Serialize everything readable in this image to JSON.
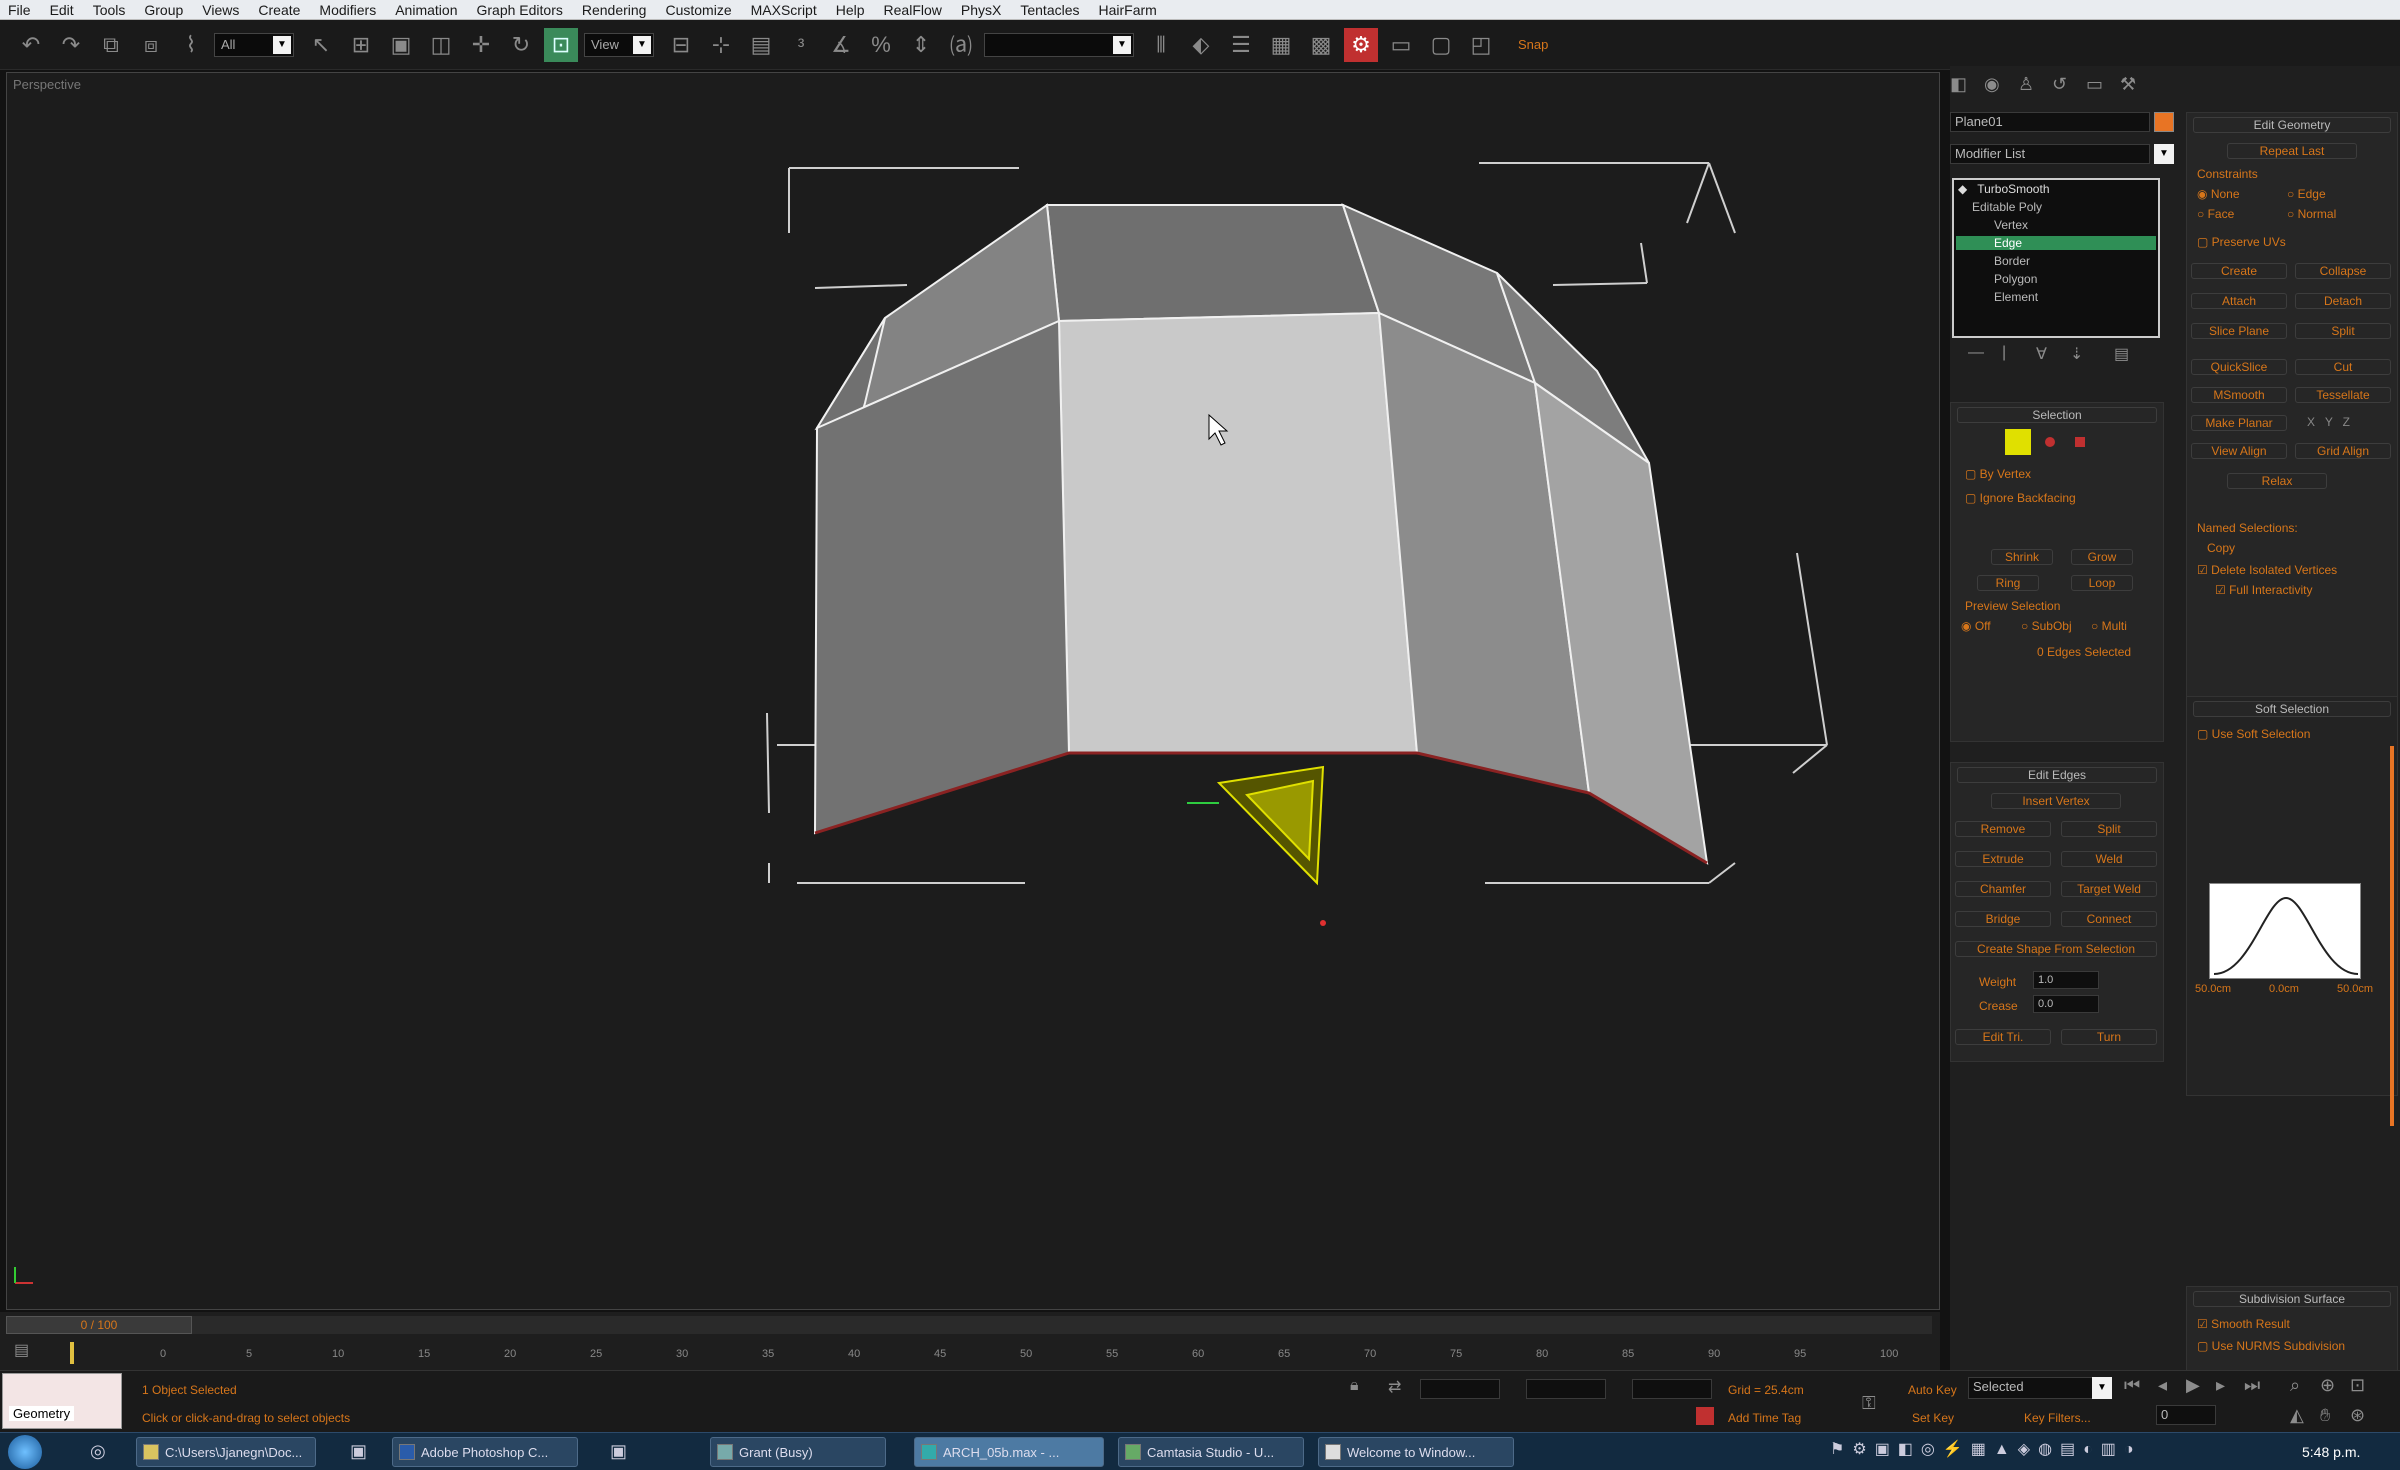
{
  "menu": [
    "File",
    "Edit",
    "Tools",
    "Group",
    "Views",
    "Create",
    "Modifiers",
    "Animation",
    "Graph Editors",
    "Rendering",
    "Customize",
    "MAXScript",
    "Help",
    "RealFlow",
    "PhysX",
    "Tentacles",
    "HairFarm"
  ],
  "toolbar": {
    "selection_filter": "All",
    "ref_coord": "View",
    "snaps_label": "Snap",
    "named_selection": ""
  },
  "viewport": {
    "label": "Perspective",
    "cursor": "arrow"
  },
  "command_panel": {
    "object_name": "Plane01",
    "modifier_list": "Modifier List",
    "stack": [
      "TurboSmooth",
      "Editable Poly",
      "Vertex",
      "Edge",
      "Border",
      "Polygon",
      "Element"
    ],
    "selected_stack_item": "Edge",
    "selection_rollout": {
      "title": "Selection",
      "by_vertex": "By Vertex",
      "ignore_backfacing": "Ignore Backfacing",
      "shrink": "Shrink",
      "grow": "Grow",
      "ring": "Ring",
      "loop": "Loop",
      "preview_selection": "Preview Selection",
      "off": "Off",
      "subobj": "SubObj",
      "multi": "Multi",
      "status": "0 Edges Selected"
    },
    "edit_edges_rollout": {
      "title": "Edit Edges",
      "insert_vertex": "Insert Vertex",
      "remove": "Remove",
      "split": "Split",
      "extrude": "Extrude",
      "weld": "Weld",
      "chamfer": "Chamfer",
      "target_weld": "Target Weld",
      "bridge": "Bridge",
      "connect": "Connect",
      "create_shape": "Create Shape From Selection",
      "weight_label": "Weight",
      "weight_value": "1.0",
      "crease_label": "Crease",
      "crease_value": "0.0",
      "edit_tri": "Edit Tri.",
      "turn": "Turn"
    },
    "edit_geometry_rollout": {
      "title": "Edit Geometry",
      "repeat_last": "Repeat Last",
      "constraints": "Constraints",
      "none": "None",
      "edge": "Edge",
      "face": "Face",
      "normal": "Normal",
      "preserve_uvs": "Preserve UVs",
      "create": "Create",
      "collapse": "Collapse",
      "attach": "Attach",
      "detach": "Detach",
      "slice_plane": "Slice Plane",
      "split": "Split",
      "quickslice": "QuickSlice",
      "cut": "Cut",
      "msmooth": "MSmooth",
      "tessellate": "Tessellate",
      "make_planar": "Make Planar",
      "x": "X",
      "y": "Y",
      "z": "Z",
      "view_align": "View Align",
      "grid_align": "Grid Align",
      "relax": "Relax",
      "named_selections": "Named Selections:",
      "copy": "Copy",
      "delete_isolated": "Delete Isolated Vertices",
      "full_interactivity": "Full Interactivity"
    },
    "soft_selection_rollout": {
      "title": "Soft Selection",
      "use_soft": "Use Soft Selection",
      "curve_left": "50.0cm",
      "curve_mid": "0.0cm",
      "curve_right": "50.0cm"
    },
    "subdivision_rollout": {
      "title": "Subdivision Surface",
      "smooth_result": "Smooth Result",
      "use_nurms": "Use NURMS Subdivision"
    }
  },
  "timeline": {
    "frame": "0 / 100",
    "ticks": [
      "0",
      "5",
      "10",
      "15",
      "20",
      "25",
      "30",
      "35",
      "40",
      "45",
      "50",
      "55",
      "60",
      "65",
      "70",
      "75",
      "80",
      "85",
      "90",
      "95",
      "100"
    ]
  },
  "status": {
    "script_listener": "Geometry",
    "selected": "1 Object Selected",
    "prompt": "Click or click-and-drag to select objects",
    "grid": "Grid = 25.4cm",
    "add_time_tag": "Add Time Tag",
    "auto_key": "Auto Key",
    "auto_key_value": "Selected",
    "set_key": "Set Key",
    "key_filters": "Key Filters...",
    "frame_value": "0"
  },
  "taskbar": {
    "items": [
      "C:\\Users\\Jjanegn\\Doc...",
      "Adobe Photoshop C...",
      "Grant (Busy)",
      "ARCH_05b.max - ...",
      "Camtasia Studio - U...",
      "Welcome to Window..."
    ],
    "active_index": 3,
    "clock": "5:48 p.m."
  },
  "colors": {
    "accent": "#d7761a",
    "stack_highlight": "#2f8f56",
    "soft_sel": "#e0e000",
    "menubar": "#e9ecf0"
  }
}
